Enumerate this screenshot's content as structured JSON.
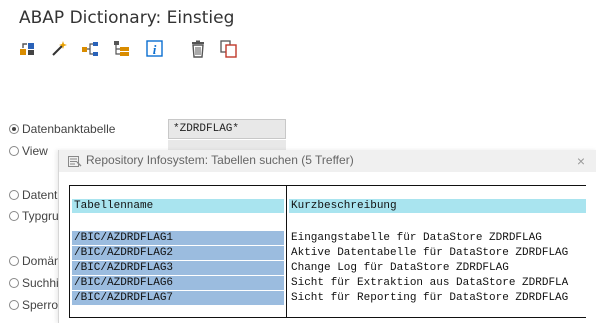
{
  "window": {
    "title": "ABAP Dictionary: Einstieg"
  },
  "toolbar": {
    "icons": [
      "other-object-icon",
      "wand-icon",
      "where-used-icon",
      "hierarchy-icon",
      "info-icon",
      "delete-icon",
      "copy-icon"
    ]
  },
  "object_types": {
    "datenbanktabelle": "Datenbanktabelle",
    "view": "View",
    "datentyp": "Datent",
    "typgruppe": "Typgru",
    "domaene": "Domän",
    "suchhilfe": "Suchhi",
    "sperrobjekt": "Sperro"
  },
  "table_field": {
    "value": "*ZDRDFLAG*"
  },
  "dialog": {
    "title": "Repository Infosystem: Tabellen suchen (5 Treffer)",
    "close": "×",
    "columns": [
      "Tabellenname",
      "Kurzbeschreibung"
    ],
    "rows": [
      {
        "name": "/BIC/AZDRDFLAG1",
        "desc": "Eingangstabelle für DataStore ZDRDFLAG"
      },
      {
        "name": "/BIC/AZDRDFLAG2",
        "desc": "Aktive Datentabelle für DataStore ZDRDFLAG"
      },
      {
        "name": "/BIC/AZDRDFLAG3",
        "desc": "Change Log für DataStore ZDRDFLAG"
      },
      {
        "name": "/BIC/AZDRDFLAG6",
        "desc": "Sicht für Extraktion aus DataStore ZDRDFLA"
      },
      {
        "name": "/BIC/AZDRDFLAG7",
        "desc": "Sicht für Reporting für DataStore ZDRDFLAG"
      }
    ]
  },
  "colors": {
    "header_bg": "#a9e4ef",
    "selected_bg": "#9bbcdf",
    "accent": "#0a6ed1"
  }
}
